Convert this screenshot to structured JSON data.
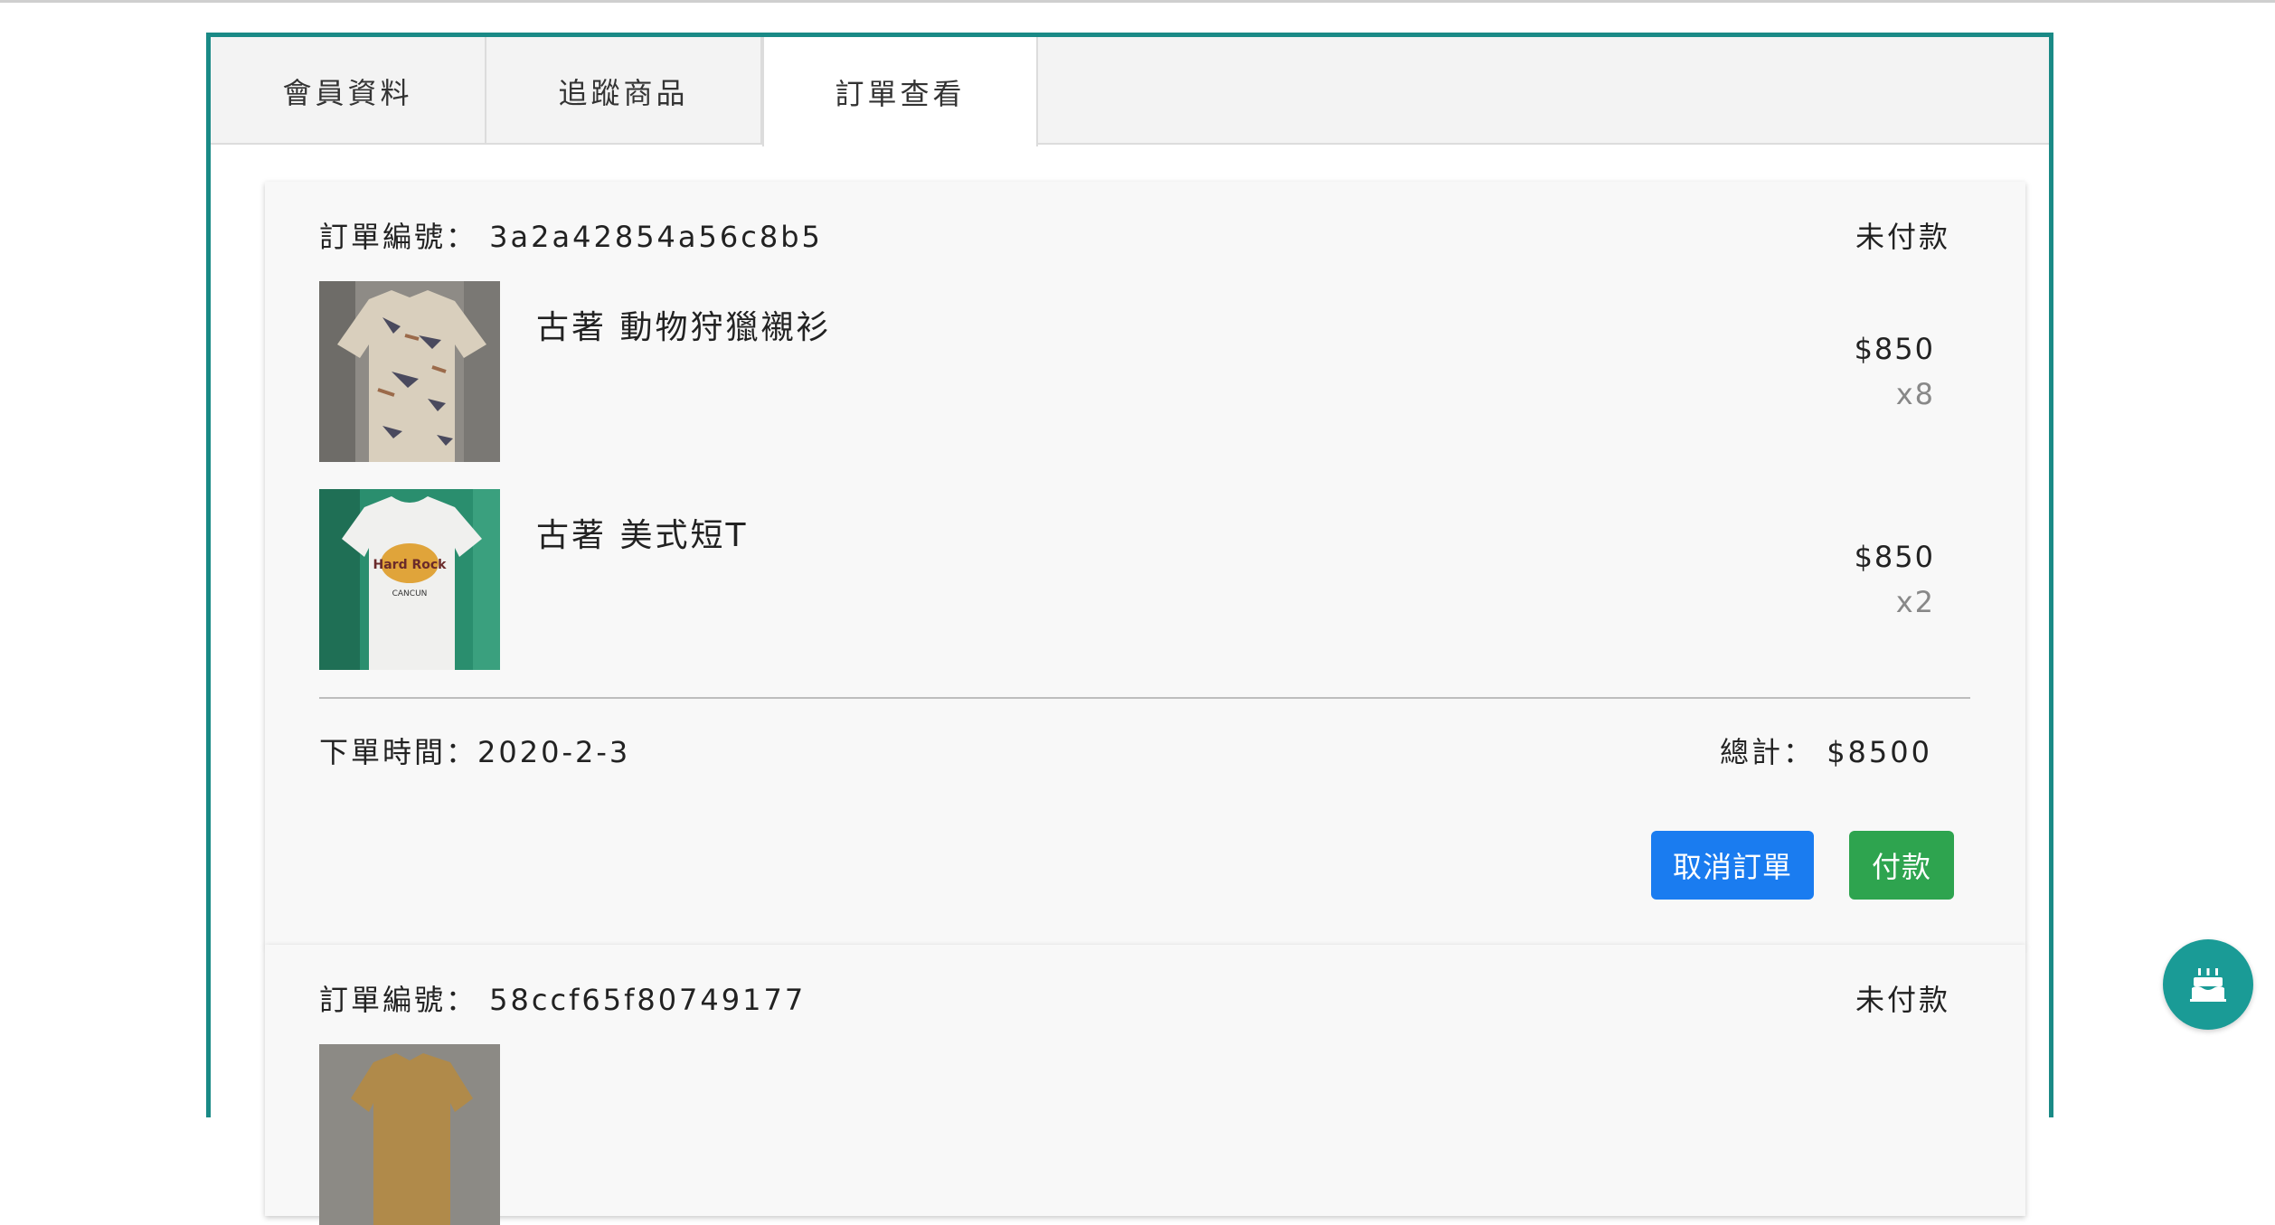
{
  "tabs": [
    {
      "label": "會員資料",
      "active": false
    },
    {
      "label": "追蹤商品",
      "active": false
    },
    {
      "label": "訂單查看",
      "active": true
    }
  ],
  "orders": [
    {
      "id_label": "訂單編號： 3a2a42854a56c8b5",
      "status": "未付款",
      "items": [
        {
          "name": "古著 動物狩獵襯衫",
          "price": "$850",
          "qty": "x8"
        },
        {
          "name": "古著 美式短T",
          "price": "$850",
          "qty": "x2"
        }
      ],
      "order_time": "下單時間：2020-2-3",
      "total": "總計： $8500",
      "cancel_label": "取消訂單",
      "pay_label": "付款"
    },
    {
      "id_label": "訂單編號： 58ccf65f80749177",
      "status": "未付款"
    }
  ],
  "colors": {
    "panel_border": "#1a8a86",
    "cancel_button": "#1a7cf0",
    "pay_button": "#2ea44f",
    "fab": "#1a9b96"
  },
  "icons": {
    "fab": "birthday-cake-icon"
  }
}
